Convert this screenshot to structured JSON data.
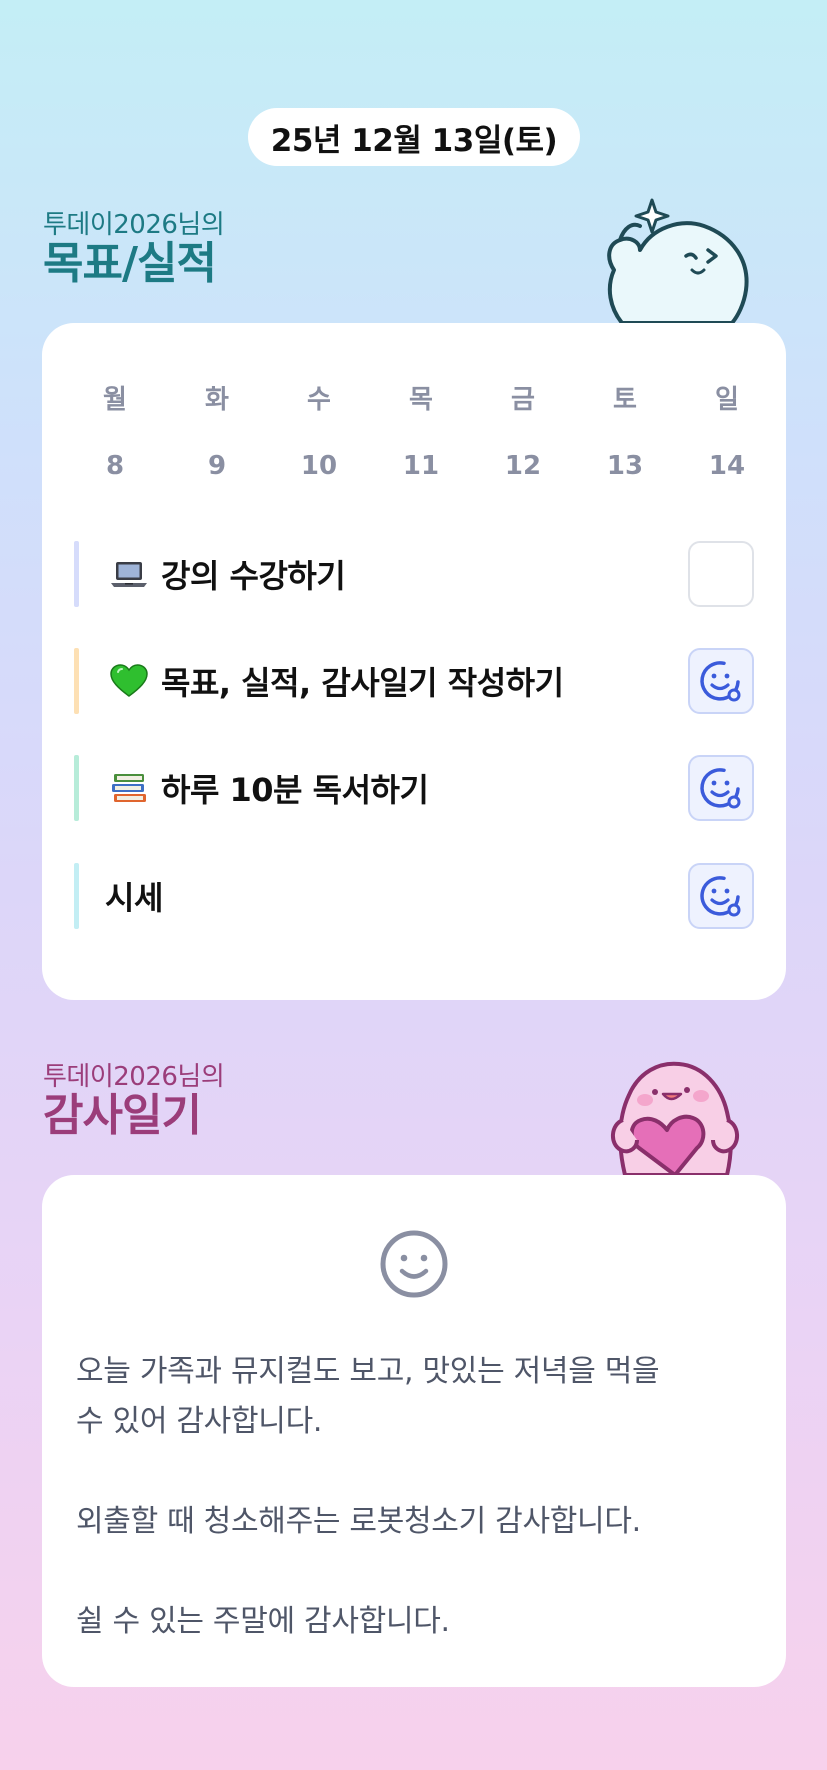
{
  "date": "25년 12월 13일(토)",
  "goal_section": {
    "subtitle": "투데이2026님의",
    "title": "목표/실적"
  },
  "week": {
    "days": [
      "월",
      "화",
      "수",
      "목",
      "금",
      "토",
      "일"
    ],
    "dates": [
      "8",
      "9",
      "10",
      "11",
      "12",
      "13",
      "14"
    ]
  },
  "goals": [
    {
      "emoji": "laptop-icon",
      "label": "강의 수강하기",
      "bar_color": "#d6dcfb",
      "done": false
    },
    {
      "emoji": "green-heart-icon",
      "label": "목표, 실적, 감사일기 작성하기",
      "bar_color": "#fde0b4",
      "done": true
    },
    {
      "emoji": "books-icon",
      "label": "하루 10분 독서하기",
      "bar_color": "#b7ecd9",
      "done": true
    },
    {
      "emoji": "",
      "label": "시세",
      "bar_color": "#c3eef4",
      "done": true
    }
  ],
  "thanks_section": {
    "subtitle": "투데이2026님의",
    "title": "감사일기"
  },
  "thanks_lines": [
    "오늘 가족과 뮤지컬도 보고, 맛있는 저녁을 먹을",
    "수 있어 감사합니다.",
    "",
    "외출할 때 청소해주는 로봇청소기 감사합니다.",
    "",
    "쉴 수 있는 주말에 감사합니다."
  ],
  "colors": {
    "goal_title": "#1d7a84",
    "thanks_title": "#9b3d7a",
    "check_done": "#3b5bdb"
  }
}
